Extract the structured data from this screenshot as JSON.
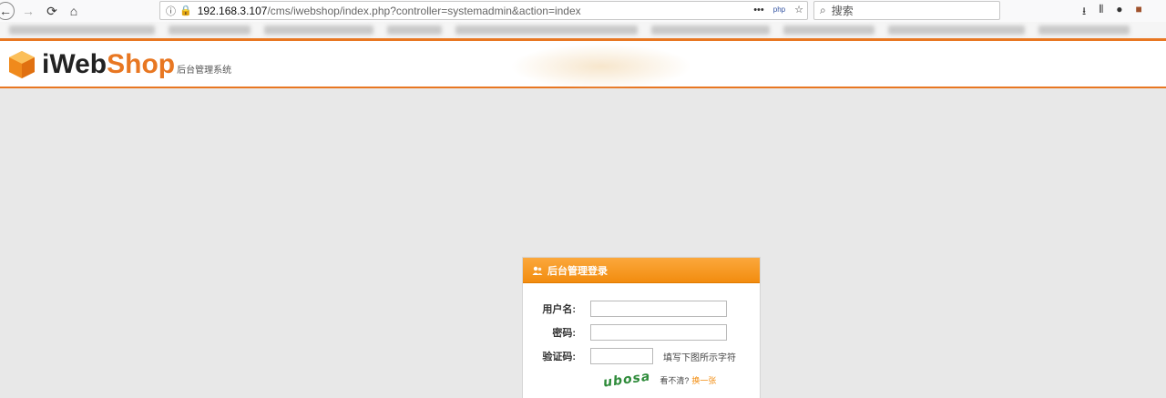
{
  "browser": {
    "url_host": "192.168.3.107",
    "url_path": "/cms/iwebshop/index.php?controller=systemadmin&action=index",
    "url_more": "•••",
    "url_php_badge": "php",
    "search_placeholder": "搜索"
  },
  "header": {
    "logo_i": "iWeb",
    "logo_shop": "Shop",
    "logo_subtitle": "后台管理系统"
  },
  "login": {
    "title": "后台管理登录",
    "username_label": "用户名:",
    "password_label": "密码:",
    "captcha_label": "验证码:",
    "captcha_hint": "填写下图所示字符",
    "captcha_text": "ubosa",
    "unclear_text": "看不清?",
    "change_link": "换一张"
  },
  "colors": {
    "accent": "#e87722",
    "panel_head": "#f28c0f",
    "captcha": "#2e8b3a"
  }
}
